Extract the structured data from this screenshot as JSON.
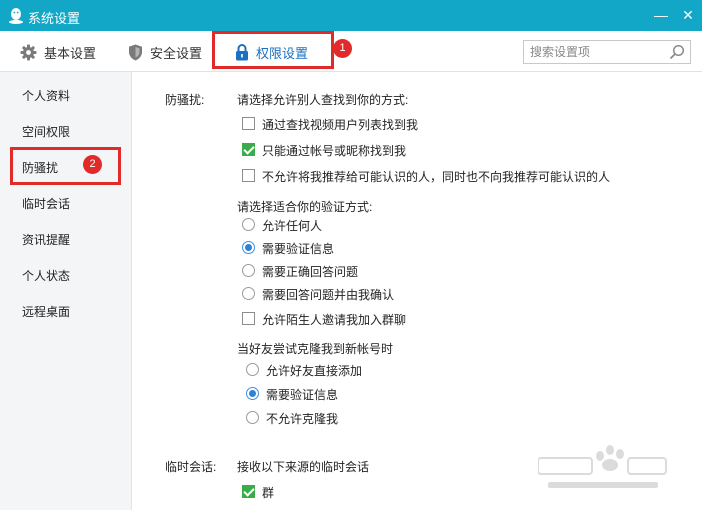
{
  "window": {
    "title": "系统设置",
    "minimize": "—",
    "close": "✕"
  },
  "toolbar": {
    "tabs": [
      {
        "label": "基本设置",
        "icon": "gear-icon"
      },
      {
        "label": "安全设置",
        "icon": "shield-icon"
      },
      {
        "label": "权限设置",
        "icon": "lock-icon",
        "active": true
      }
    ],
    "search_placeholder": "搜索设置项",
    "step1": "1"
  },
  "sidebar": {
    "items": [
      "个人资料",
      "空间权限",
      "防骚扰",
      "临时会话",
      "资讯提醒",
      "个人状态",
      "远程桌面"
    ],
    "active_index": 2,
    "step2": "2"
  },
  "anti_harass": {
    "section_label": "防骚扰:",
    "find_title": "请选择允许别人查找到你的方式:",
    "find_options": [
      {
        "label": "通过查找视频用户列表找到我",
        "checked": false
      },
      {
        "label": "只能通过帐号或昵称找到我",
        "checked": true
      },
      {
        "label": "不允许将我推荐给可能认识的人，同时也不向我推荐可能认识的人",
        "checked": false
      }
    ],
    "verify_title": "请选择适合你的验证方式:",
    "verify_options": [
      {
        "label": "允许任何人",
        "checked": false
      },
      {
        "label": "需要验证信息",
        "checked": true
      },
      {
        "label": "需要正确回答问题",
        "checked": false
      },
      {
        "label": "需要回答问题并由我确认",
        "checked": false
      }
    ],
    "group_invite": {
      "label": "允许陌生人邀请我加入群聊",
      "checked": false
    },
    "clone_title": "当好友尝试克隆我到新帐号时",
    "clone_options": [
      {
        "label": "允许好友直接添加",
        "checked": false
      },
      {
        "label": "需要验证信息",
        "checked": true
      },
      {
        "label": "不允许克隆我",
        "checked": false
      }
    ]
  },
  "temp_session": {
    "section_label": "临时会话:",
    "title": "接收以下来源的临时会话",
    "options": [
      {
        "label": "群",
        "checked": true
      }
    ]
  },
  "colors": {
    "titlebar": "#12a6c7",
    "highlight": "#e12b2b",
    "accent": "#1d6fc2",
    "checkbox": "#3cac4a",
    "radio": "#2b82d9"
  }
}
